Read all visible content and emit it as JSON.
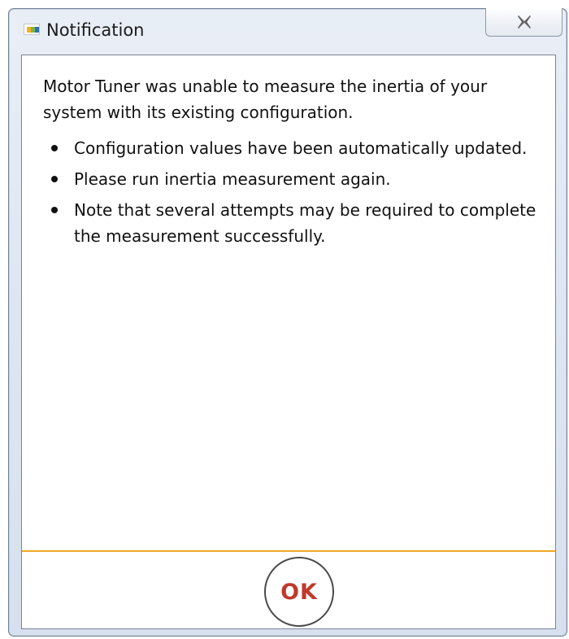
{
  "window": {
    "title": "Notification",
    "icon": "nxp-logo-icon",
    "close_icon": "close-icon"
  },
  "message": {
    "intro": "Motor Tuner was unable to measure the inertia of your system with its existing configuration.",
    "points": [
      "Configuration values have been automatically updated.",
      "Please run inertia measurement again.",
      "Note that several attempts may be required to complete the measurement successfully."
    ]
  },
  "actions": {
    "ok_label": "OK"
  },
  "colors": {
    "accent_line": "#f0a824",
    "ok_text": "#c0392b",
    "logo": [
      "#f3b21b",
      "#7ab648",
      "#2f6fb7"
    ]
  }
}
